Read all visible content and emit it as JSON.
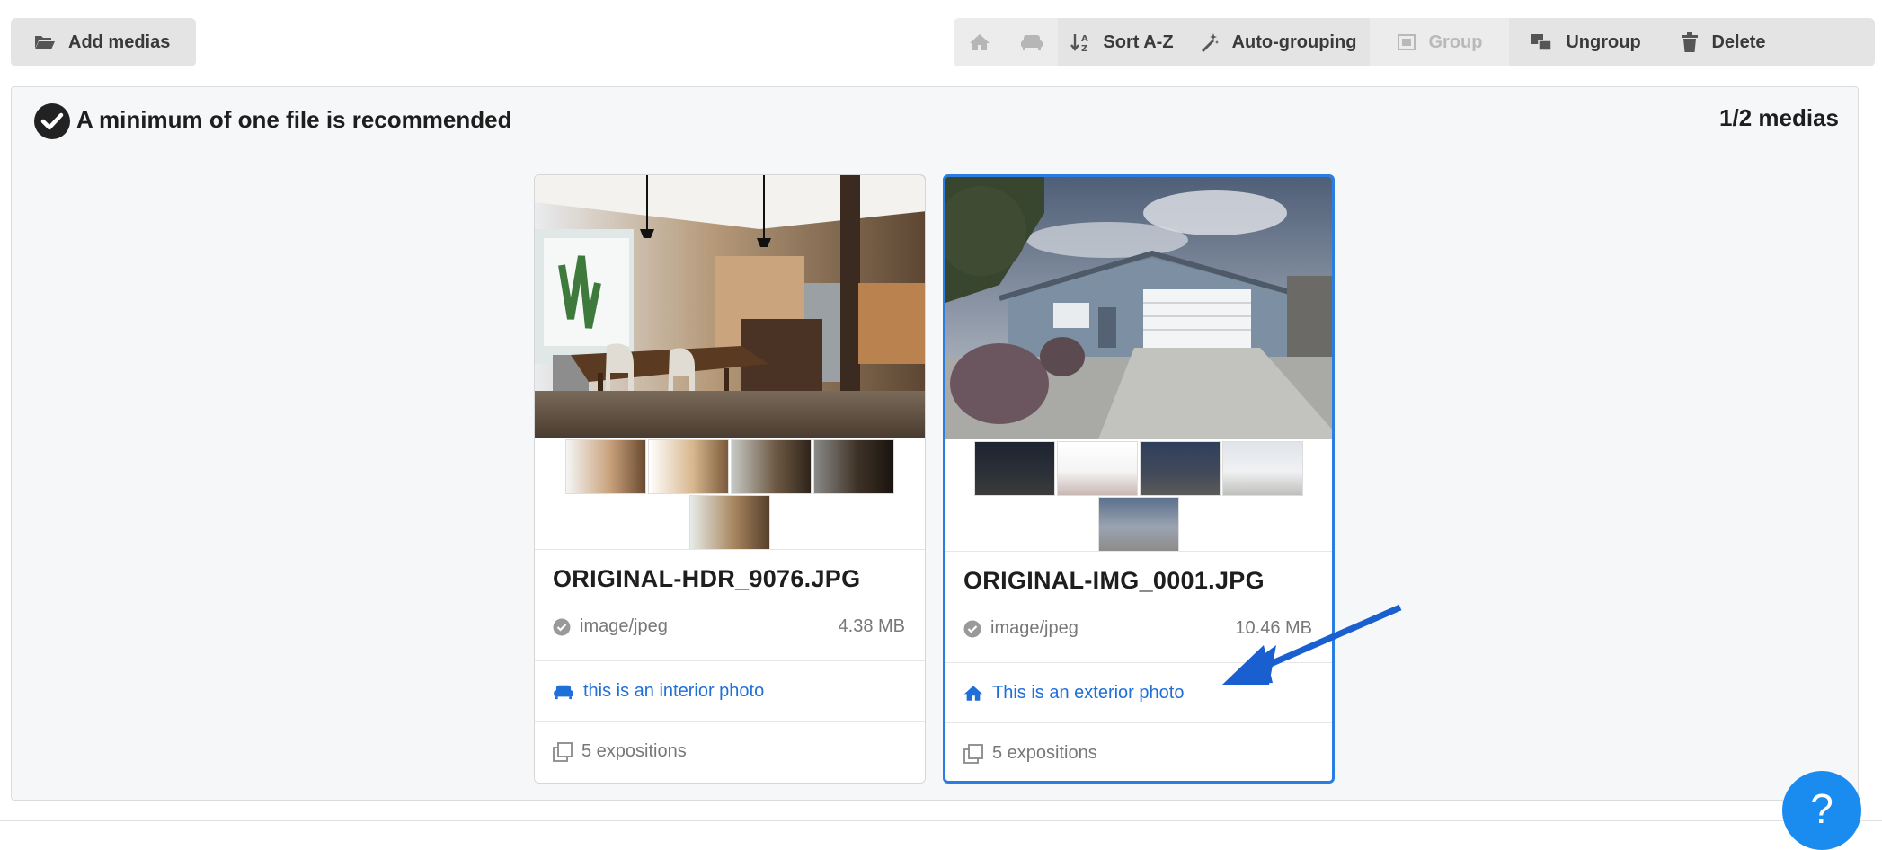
{
  "toolbar_left": {
    "add_label": "Add medias"
  },
  "toolbar": {
    "sort_label": "Sort A-Z",
    "autogroup_label": "Auto-grouping",
    "group_label": "Group",
    "ungroup_label": "Ungroup",
    "delete_label": "Delete"
  },
  "panel": {
    "title": "A minimum of one file is recommended",
    "count": "1/2 medias"
  },
  "cards": [
    {
      "filename": "ORIGINAL-HDR_9076.JPG",
      "type": "image/jpeg",
      "size": "4.38 MB",
      "tag": "this is an interior photo",
      "tag_icon": "couch-icon",
      "expositions": "5 expositions",
      "selected": false
    },
    {
      "filename": "ORIGINAL-IMG_0001.JPG",
      "type": "image/jpeg",
      "size": "10.46 MB",
      "tag": "This is an exterior photo",
      "tag_icon": "home-icon",
      "expositions": "5 expositions",
      "selected": true
    }
  ],
  "help": {
    "label": "?"
  },
  "colors": {
    "accent": "#2a7de1",
    "link": "#1f6fd8",
    "help": "#1a8cf0",
    "arrow": "#1a5fd0"
  }
}
